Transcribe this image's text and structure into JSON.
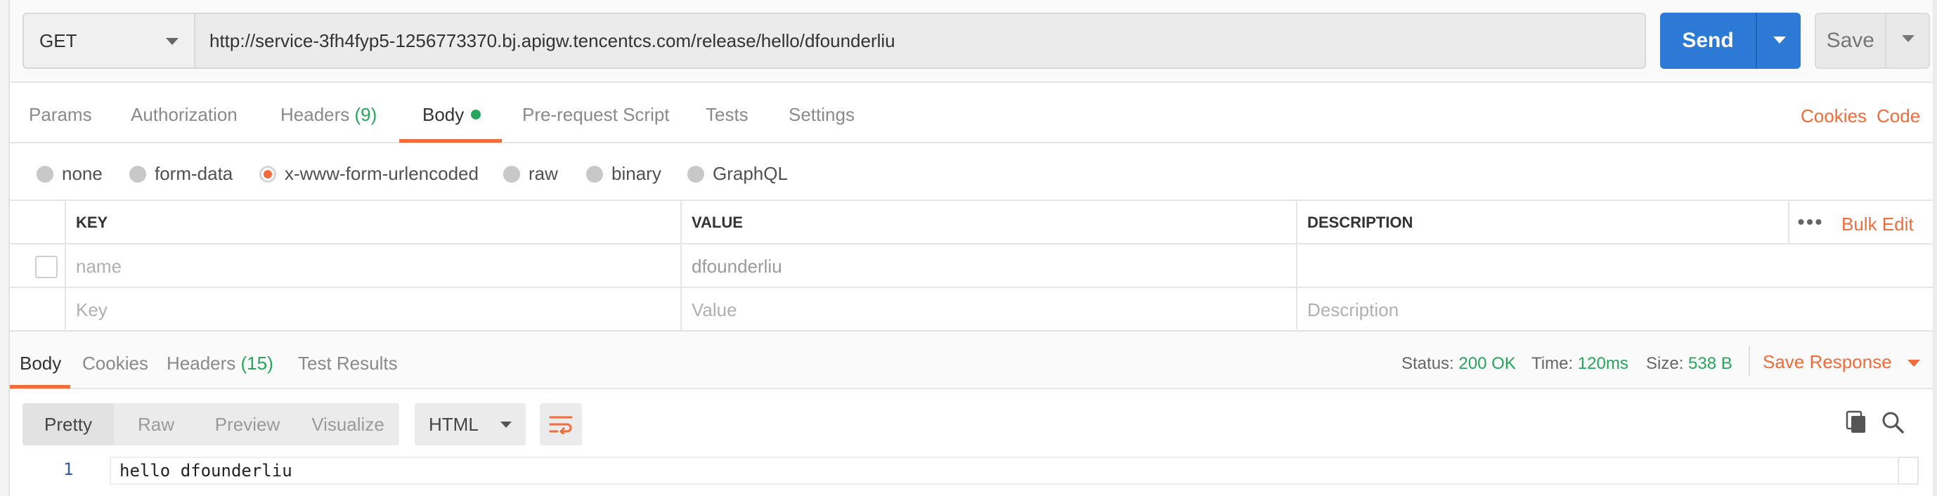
{
  "request": {
    "method": "GET",
    "url": "http://service-3fh4fyp5-1256773370.bj.apigw.tencentcs.com/release/hello/dfounderliu",
    "send_label": "Send",
    "save_label": "Save"
  },
  "request_tabs": [
    {
      "label": "Params"
    },
    {
      "label": "Authorization"
    },
    {
      "label": "Headers",
      "count": "(9)"
    },
    {
      "label": "Body"
    },
    {
      "label": "Pre-request Script"
    },
    {
      "label": "Tests"
    },
    {
      "label": "Settings"
    }
  ],
  "request_links": {
    "cookies": "Cookies",
    "code": "Code"
  },
  "body_types": [
    {
      "label": "none"
    },
    {
      "label": "form-data"
    },
    {
      "label": "x-www-form-urlencoded",
      "selected": true
    },
    {
      "label": "raw"
    },
    {
      "label": "binary"
    },
    {
      "label": "GraphQL"
    }
  ],
  "kv_table": {
    "headers": {
      "key": "KEY",
      "value": "VALUE",
      "description": "DESCRIPTION"
    },
    "bulk_edit": "Bulk Edit",
    "rows": [
      {
        "key": "name",
        "value": "dfounderliu",
        "description": ""
      }
    ],
    "placeholders": {
      "key": "Key",
      "value": "Value",
      "description": "Description"
    }
  },
  "response_tabs": [
    {
      "label": "Body"
    },
    {
      "label": "Cookies"
    },
    {
      "label": "Headers",
      "count": "(15)"
    },
    {
      "label": "Test Results"
    }
  ],
  "response_stats": {
    "status_label": "Status:",
    "status_value": "200 OK",
    "time_label": "Time:",
    "time_value": "120ms",
    "size_label": "Size:",
    "size_value": "538 B"
  },
  "save_response": "Save Response",
  "view_modes": [
    "Pretty",
    "Raw",
    "Preview",
    "Visualize"
  ],
  "format": "HTML",
  "code": {
    "line_number": "1",
    "text": "hello dfounderliu"
  },
  "colors": {
    "accent": "#f26b3a",
    "send": "#2d7ad6",
    "success": "#26a65b"
  }
}
